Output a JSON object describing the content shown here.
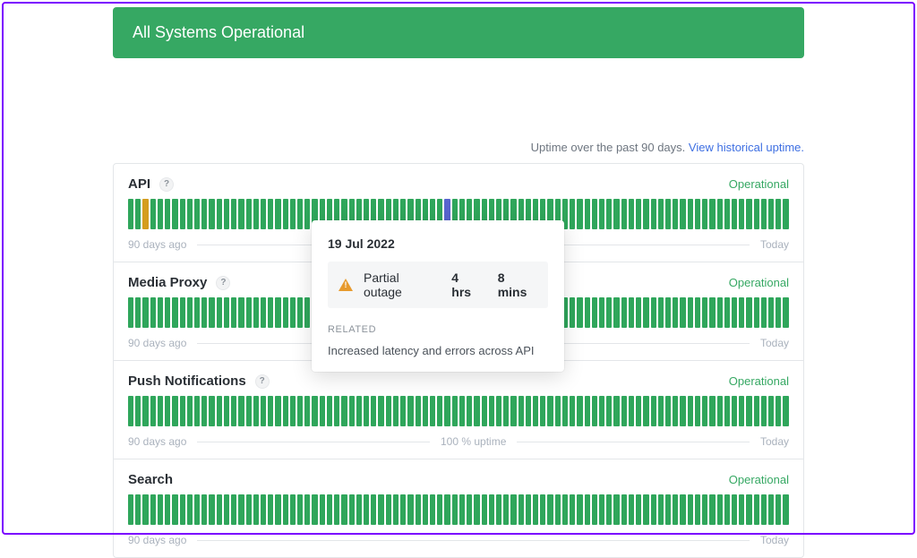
{
  "banner": {
    "title": "All Systems Operational"
  },
  "intro": {
    "text": "Uptime over the past 90 days.",
    "link": "View historical uptime."
  },
  "axis": {
    "left": "90 days ago",
    "right": "Today"
  },
  "components": [
    {
      "name": "API",
      "status": "Operational",
      "has_help": true,
      "uptime_center": "",
      "anomalies": {
        "2": "yellow",
        "43": "blue"
      }
    },
    {
      "name": "Media Proxy",
      "status": "Operational",
      "has_help": true,
      "uptime_center": "",
      "anomalies": {}
    },
    {
      "name": "Push Notifications",
      "status": "Operational",
      "has_help": true,
      "uptime_center": "100 % uptime",
      "anomalies": {}
    },
    {
      "name": "Search",
      "status": "Operational",
      "has_help": false,
      "uptime_center": "",
      "anomalies": {}
    }
  ],
  "tooltip": {
    "date": "19 Jul 2022",
    "severity": "Partial outage",
    "hrs": "4 hrs",
    "mins": "8 mins",
    "related_label": "RELATED",
    "related_text": "Increased latency and errors across API"
  },
  "bars_per_track": 90
}
